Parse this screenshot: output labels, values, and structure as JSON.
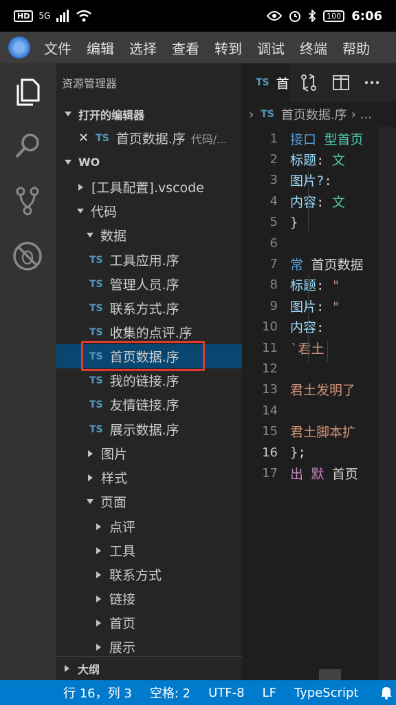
{
  "phone": {
    "hd": "HD",
    "signal": "5G",
    "battery": "100",
    "time": "6:06"
  },
  "menu": [
    "文件",
    "编辑",
    "选择",
    "查看",
    "转到",
    "调试",
    "终端",
    "帮助"
  ],
  "sidebar": {
    "title": "资源管理器",
    "open_editors_label": "打开的编辑器",
    "open_editor": {
      "badge": "TS",
      "name": "首页数据.序",
      "path": "代码/..."
    },
    "workspace_label": "WO",
    "tree": [
      {
        "label": "[工具配置].vscode",
        "type": "folder-collapsed"
      },
      {
        "label": "代码",
        "type": "folder-open"
      },
      {
        "label": "数据",
        "type": "folder-open"
      },
      {
        "label": "工具应用.序",
        "type": "ts"
      },
      {
        "label": "管理人员.序",
        "type": "ts"
      },
      {
        "label": "联系方式.序",
        "type": "ts"
      },
      {
        "label": "收集的点评.序",
        "type": "ts"
      },
      {
        "label": "首页数据.序",
        "type": "ts",
        "selected": true
      },
      {
        "label": "我的链接.序",
        "type": "ts"
      },
      {
        "label": "友情链接.序",
        "type": "ts"
      },
      {
        "label": "展示数据.序",
        "type": "ts"
      },
      {
        "label": "图片",
        "type": "folder-collapsed"
      },
      {
        "label": "样式",
        "type": "folder-collapsed"
      },
      {
        "label": "页面",
        "type": "folder-open"
      },
      {
        "label": "点评",
        "type": "folder-collapsed"
      },
      {
        "label": "工具",
        "type": "folder-collapsed"
      },
      {
        "label": "联系方式",
        "type": "folder-collapsed"
      },
      {
        "label": "链接",
        "type": "folder-collapsed"
      },
      {
        "label": "首页",
        "type": "folder-collapsed"
      },
      {
        "label": "展示",
        "type": "folder-collapsed"
      }
    ],
    "outline_label": "大纲"
  },
  "tab": {
    "badge": "TS",
    "name": "首"
  },
  "breadcrumb": {
    "badge": "TS",
    "file": "首页数据.序",
    "sep": "›",
    "more": "..."
  },
  "code_lines": [
    {
      "n": "1",
      "t": [
        [
          "kw",
          "接口 "
        ],
        [
          "ty",
          "型首页"
        ]
      ]
    },
    {
      "n": "2",
      "t": [
        [
          "code",
          "  "
        ],
        [
          "prop",
          "标题"
        ],
        [
          "code",
          ": "
        ],
        [
          "ty",
          "文"
        ]
      ]
    },
    {
      "n": "3",
      "t": [
        [
          "code",
          "  "
        ],
        [
          "prop",
          "图片?"
        ],
        [
          "code",
          ":"
        ]
      ]
    },
    {
      "n": "4",
      "t": [
        [
          "code",
          "  "
        ],
        [
          "prop",
          "内容"
        ],
        [
          "code",
          ": "
        ],
        [
          "ty",
          "文"
        ]
      ]
    },
    {
      "n": "5",
      "t": [
        [
          "code",
          "}"
        ]
      ]
    },
    {
      "n": "6",
      "t": []
    },
    {
      "n": "7",
      "t": [
        [
          "kw",
          "常 "
        ],
        [
          "code",
          "首页数据"
        ]
      ]
    },
    {
      "n": "8",
      "t": [
        [
          "code",
          "  "
        ],
        [
          "prop",
          "标题"
        ],
        [
          "code",
          ": "
        ],
        [
          "str",
          "\""
        ]
      ]
    },
    {
      "n": "9",
      "t": [
        [
          "code",
          "  "
        ],
        [
          "prop",
          "图片"
        ],
        [
          "code",
          ": "
        ],
        [
          "str",
          "\""
        ]
      ]
    },
    {
      "n": "10",
      "t": [
        [
          "code",
          "  "
        ],
        [
          "prop",
          "内容"
        ],
        [
          "code",
          ":"
        ]
      ]
    },
    {
      "n": "11",
      "t": [
        [
          "code",
          "      "
        ],
        [
          "str",
          "`君土"
        ]
      ]
    },
    {
      "n": "12",
      "t": []
    },
    {
      "n": "13",
      "t": [
        [
          "str",
          "君土发明了"
        ]
      ]
    },
    {
      "n": "14",
      "t": []
    },
    {
      "n": "15",
      "t": [
        [
          "str",
          "君土脚本扩"
        ]
      ]
    },
    {
      "n": "16",
      "t": [
        [
          "code",
          "};"
        ]
      ]
    },
    {
      "n": "17",
      "t": [
        [
          "ctl",
          "出 默 "
        ],
        [
          "code",
          "首页"
        ]
      ]
    }
  ],
  "current_line": "16",
  "status": {
    "position": "行 16，列 3",
    "spaces": "空格: 2",
    "encoding": "UTF-8",
    "eol": "LF",
    "language": "TypeScript"
  }
}
